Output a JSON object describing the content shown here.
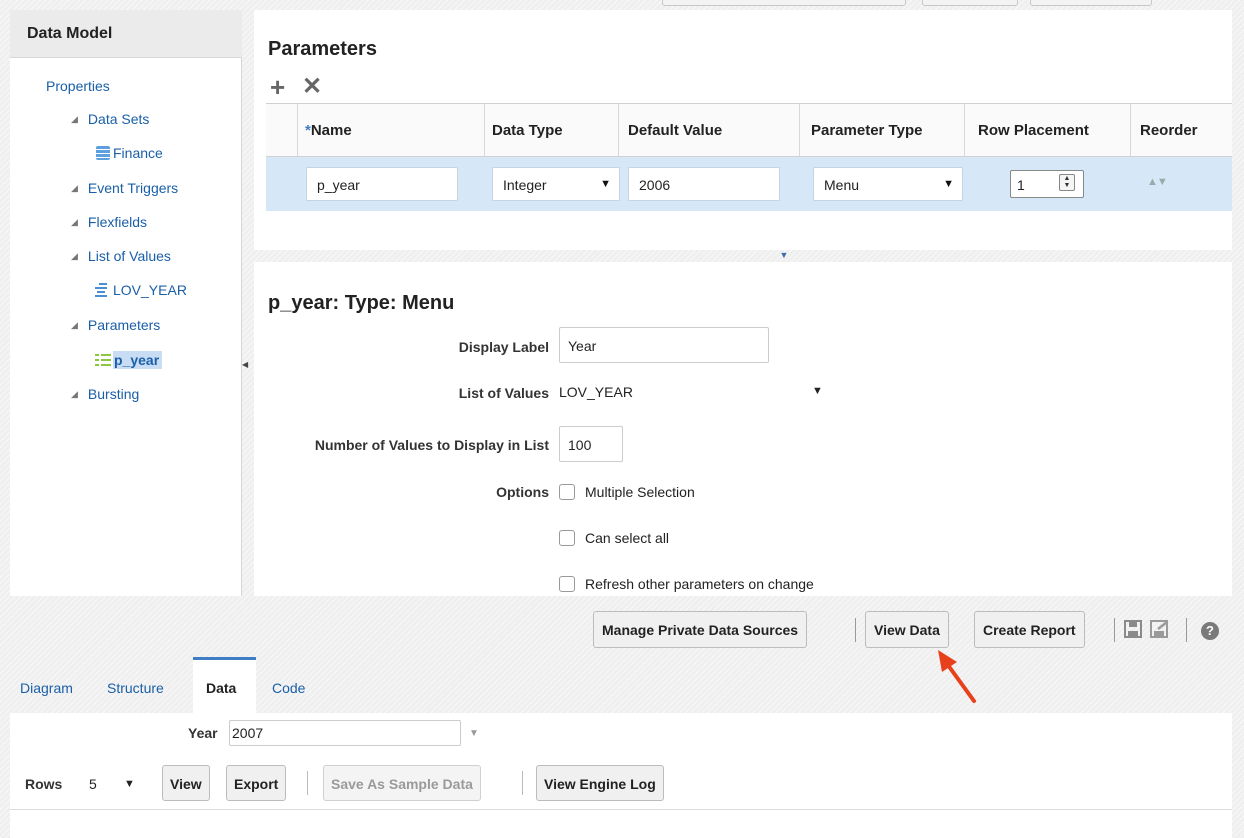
{
  "left_panel": {
    "title": "Data Model",
    "items": [
      {
        "label": "Properties"
      },
      {
        "label": "Data Sets"
      },
      {
        "label": "Finance"
      },
      {
        "label": "Event Triggers"
      },
      {
        "label": "Flexfields"
      },
      {
        "label": "List of Values"
      },
      {
        "label": "LOV_YEAR"
      },
      {
        "label": "Parameters"
      },
      {
        "label": "p_year"
      },
      {
        "label": "Bursting"
      }
    ],
    "tree_toggle_glyph": "◢"
  },
  "parameters_panel": {
    "title": "Parameters",
    "add_glyph": "+",
    "delete_glyph": "✕",
    "columns": {
      "required_marker": "*",
      "name": "Name",
      "data_type": "Data Type",
      "default_value": "Default Value",
      "parameter_type": "Parameter Type",
      "row_placement": "Row Placement",
      "reorder": "Reorder"
    },
    "row": {
      "name": "p_year",
      "data_type": "Integer",
      "default_value": "2006",
      "parameter_type": "Menu",
      "row_placement": "1"
    }
  },
  "detail_panel": {
    "title": "p_year: Type: Menu",
    "display_label_label": "Display Label",
    "display_label_value": "Year",
    "list_of_values_label": "List of Values",
    "list_of_values_value": "LOV_YEAR",
    "num_values_label": "Number of Values to Display in List",
    "num_values_value": "100",
    "options_label": "Options",
    "option_multiple_selection": "Multiple Selection",
    "option_can_select_all": "Can select all",
    "option_refresh": "Refresh other parameters on change"
  },
  "toolbar": {
    "manage_private_data_sources": "Manage Private Data Sources",
    "view_data": "View Data",
    "create_report": "Create Report",
    "help_glyph": "?"
  },
  "tabs": {
    "diagram": "Diagram",
    "structure": "Structure",
    "data": "Data",
    "code": "Code"
  },
  "data_panel": {
    "year_label": "Year",
    "year_value": "2007",
    "rows_label": "Rows",
    "rows_value": "5",
    "view_button": "View",
    "export_button": "Export",
    "save_sample_button": "Save As Sample Data",
    "engine_log_button": "View Engine Log"
  },
  "colors": {
    "link": "#1a5fa8",
    "selected_row": "#d6e7f7",
    "active_tab": "#3f7ec4",
    "annotation_arrow": "#e8401c"
  }
}
